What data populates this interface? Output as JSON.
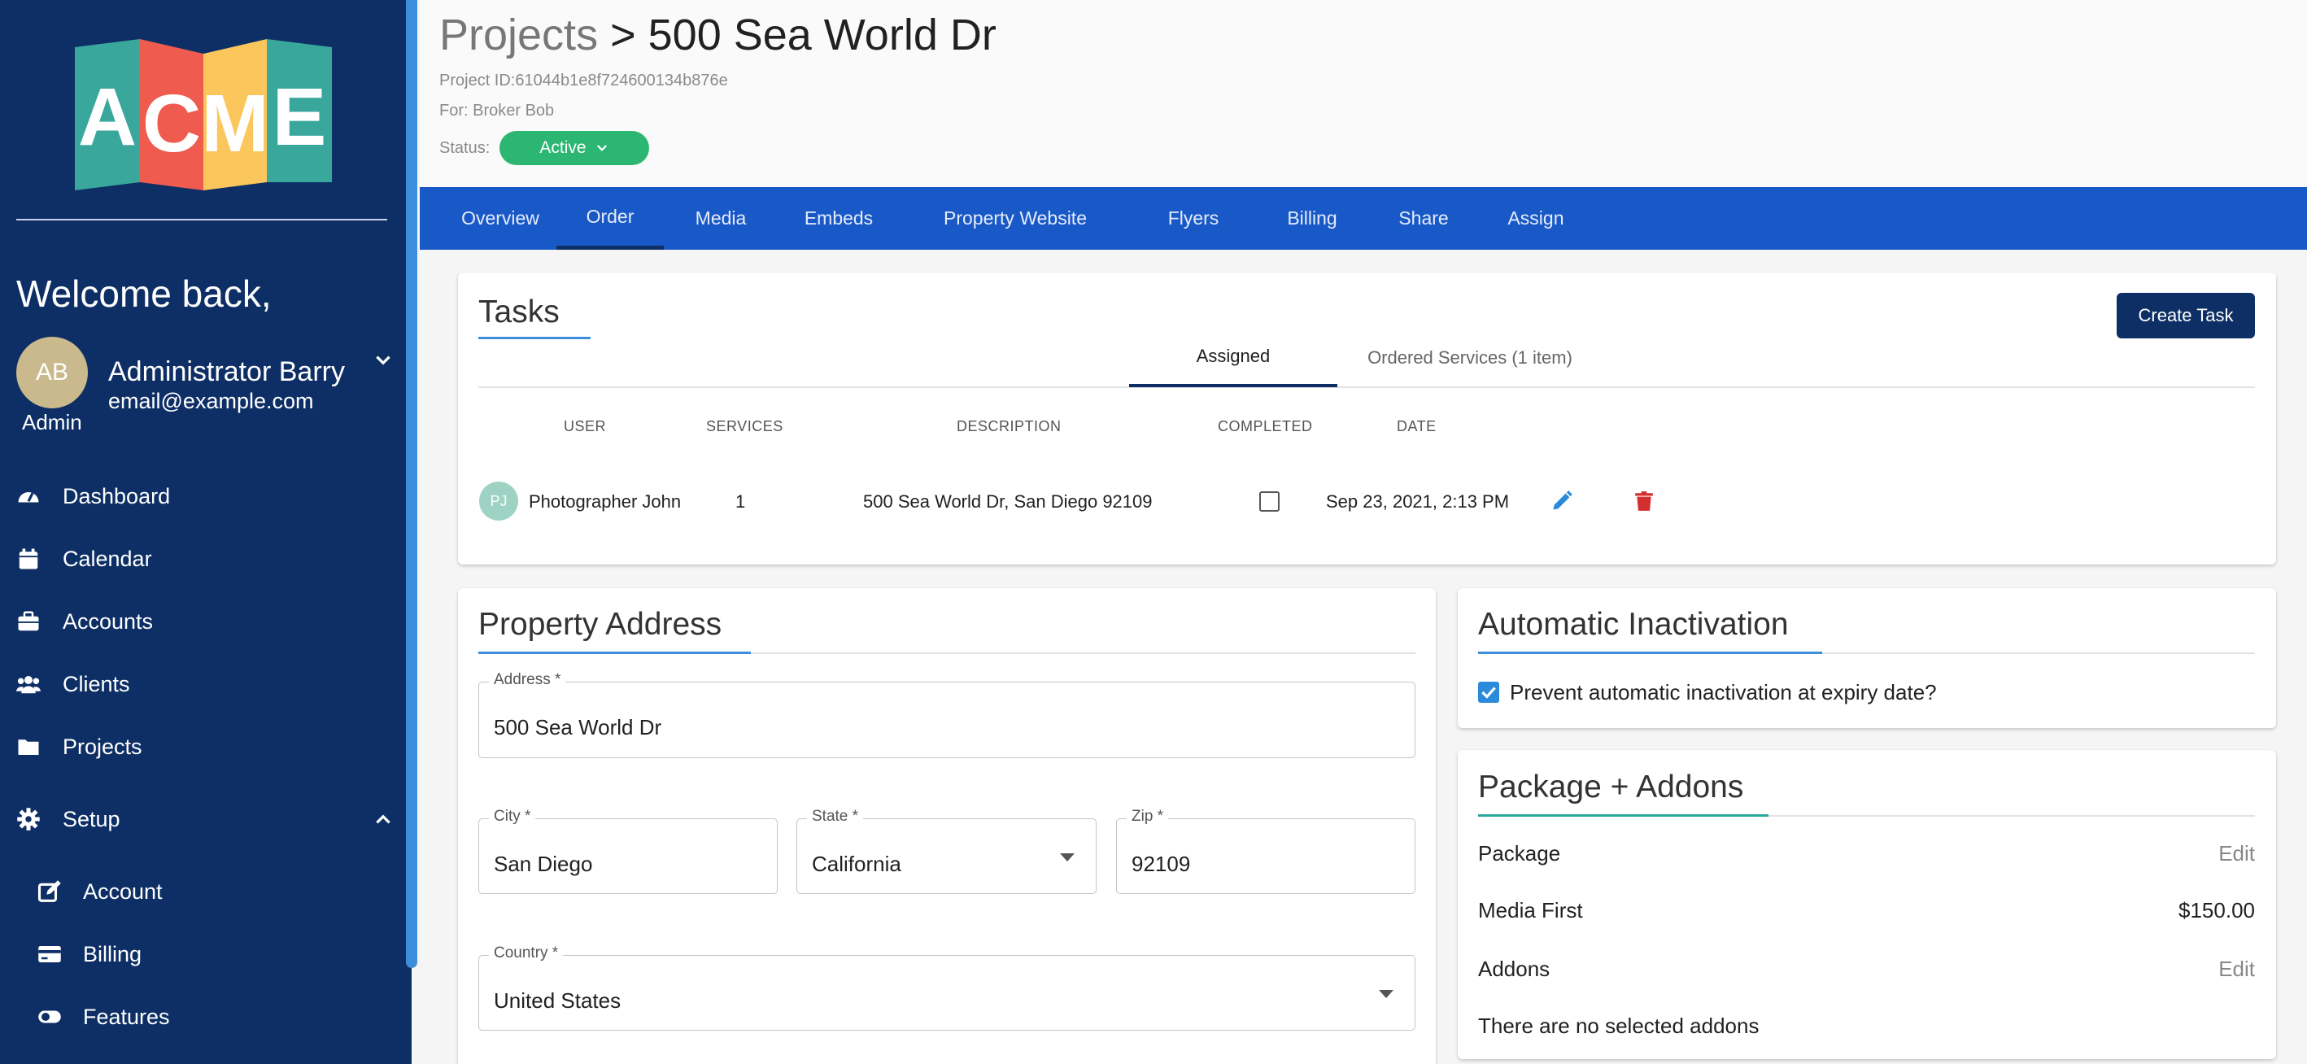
{
  "logo": {
    "letters": [
      "A",
      "C",
      "M",
      "E"
    ],
    "colors": [
      "#3aa79d",
      "#ef5b4f",
      "#fbc75c",
      "#3aa79d"
    ]
  },
  "sidebar": {
    "welcome": "Welcome back,",
    "user": {
      "initials": "AB",
      "name": "Administrator Barry",
      "email": "email@example.com",
      "role": "Admin"
    },
    "items": [
      {
        "label": "Dashboard",
        "icon": "gauge-icon"
      },
      {
        "label": "Calendar",
        "icon": "calendar-icon"
      },
      {
        "label": "Accounts",
        "icon": "briefcase-icon"
      },
      {
        "label": "Clients",
        "icon": "users-icon"
      },
      {
        "label": "Projects",
        "icon": "folder-icon"
      },
      {
        "label": "Setup",
        "icon": "gear-icon"
      }
    ],
    "setup_items": [
      {
        "label": "Account",
        "icon": "edit-icon"
      },
      {
        "label": "Billing",
        "icon": "credit-card-icon"
      },
      {
        "label": "Features",
        "icon": "toggle-icon"
      }
    ]
  },
  "header": {
    "crumb_parent": "Projects",
    "crumb_sep": " > ",
    "title": "500 Sea World Dr",
    "project_id": "Project ID:61044b1e8f724600134b876e",
    "for": "For: Broker Bob",
    "status_label": "Status:",
    "status_value": "Active"
  },
  "tabs": [
    "Overview",
    "Order",
    "Media",
    "Embeds",
    "Property Website",
    "Flyers",
    "Billing",
    "Share",
    "Assign"
  ],
  "active_tab": "Order",
  "tasks": {
    "title": "Tasks",
    "create_label": "Create Task",
    "subtabs": [
      "Assigned",
      "Ordered Services (1 item)"
    ],
    "columns": [
      "USER",
      "SERVICES",
      "DESCRIPTION",
      "COMPLETED",
      "DATE"
    ],
    "row": {
      "initials": "PJ",
      "user": "Photographer John",
      "services": "1",
      "description": "500 Sea World Dr, San Diego 92109",
      "completed": false,
      "date": "Sep 23, 2021, 2:13 PM"
    }
  },
  "property": {
    "title": "Property Address",
    "address_label": "Address *",
    "address": "500 Sea World Dr",
    "city_label": "City *",
    "city": "San Diego",
    "state_label": "State *",
    "state": "California",
    "zip_label": "Zip *",
    "zip": "92109",
    "country_label": "Country *",
    "country": "United States"
  },
  "inactivation": {
    "title": "Automatic Inactivation",
    "checkbox_label": "Prevent automatic inactivation at expiry date?",
    "checked": true
  },
  "package": {
    "title": "Package + Addons",
    "package_label": "Package",
    "edit_label": "Edit",
    "package_name": "Media First",
    "package_price": "$150.00",
    "addons_label": "Addons",
    "addons_empty": "There are no selected addons"
  },
  "colors": {
    "sidebar": "#0e2f65",
    "tabbar": "#1959c7",
    "status": "#2bb673",
    "accent": "#3d8fdc",
    "delete": "#d32f2f"
  }
}
